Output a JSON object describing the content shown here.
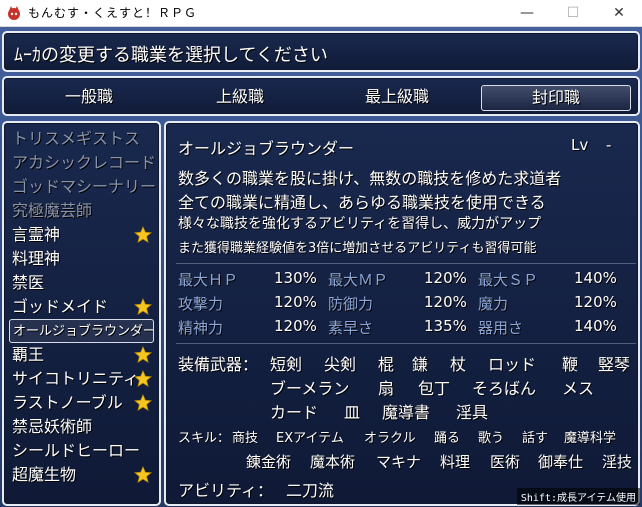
{
  "window": {
    "title": "もんむす・くえすと！ＲＰＧ",
    "minimize": "—",
    "maximize": "☐",
    "close": "✕"
  },
  "help": {
    "text": "ﾑｰｶの変更する職業を選択してください"
  },
  "categories": [
    {
      "label": "一般職",
      "selected": false
    },
    {
      "label": "上級職",
      "selected": false
    },
    {
      "label": "最上級職",
      "selected": false
    },
    {
      "label": "封印職",
      "selected": true
    }
  ],
  "job_list": [
    {
      "label": "トリスメギストス",
      "dim": true,
      "star": false
    },
    {
      "label": "アカシックレコード",
      "dim": true,
      "star": false
    },
    {
      "label": "ゴッドマシーナリー",
      "dim": true,
      "star": false
    },
    {
      "label": "究極魔芸師",
      "dim": true,
      "star": false
    },
    {
      "label": "言霊神",
      "dim": false,
      "star": true
    },
    {
      "label": "料理神",
      "dim": false,
      "star": false
    },
    {
      "label": "禁医",
      "dim": false,
      "star": false
    },
    {
      "label": "ゴッドメイド",
      "dim": false,
      "star": true
    },
    {
      "label": "オールジョブラウンダー",
      "dim": false,
      "star": false,
      "cursor": true
    },
    {
      "label": "覇王",
      "dim": false,
      "star": true
    },
    {
      "label": "サイコトリニティ",
      "dim": false,
      "star": true
    },
    {
      "label": "ラストノーブル",
      "dim": false,
      "star": true
    },
    {
      "label": "禁忌妖術師",
      "dim": false,
      "star": false
    },
    {
      "label": "シールドヒーロー",
      "dim": false,
      "star": false
    },
    {
      "label": "超魔生物",
      "dim": false,
      "star": true
    }
  ],
  "detail": {
    "name": "オールジョブラウンダー",
    "lv_label": "Lv",
    "lv_value": "-",
    "description": [
      "数多くの職業を股に掛け、無数の職技を修めた求道者",
      "全ての職業に精通し、あらゆる職業技を使用できる",
      "様々な職技を強化するアビリティを習得し、威力がアップ",
      "また獲得職業経験値を3倍に増加させるアビリティも習得可能"
    ],
    "stats": [
      [
        {
          "label": "最大ＨＰ",
          "value": "130%"
        },
        {
          "label": "最大ＭＰ",
          "value": "120%"
        },
        {
          "label": "最大ＳＰ",
          "value": "140%"
        }
      ],
      [
        {
          "label": "攻撃力",
          "value": "120%"
        },
        {
          "label": "防御力",
          "value": "120%"
        },
        {
          "label": "魔力",
          "value": "120%"
        }
      ],
      [
        {
          "label": "精神力",
          "value": "120%"
        },
        {
          "label": "素早さ",
          "value": "135%"
        },
        {
          "label": "器用さ",
          "value": "140%"
        }
      ]
    ],
    "weapons_label": "装備武器：",
    "weapons_rows": [
      [
        "短剣",
        "尖剣",
        "棍",
        "鎌",
        "杖",
        "ロッド",
        "鞭",
        "竪琴"
      ],
      [
        "ブーメラン",
        "扇",
        "包丁",
        "そろばん",
        "メス"
      ],
      [
        "カード",
        "皿",
        "魔導書",
        "淫具"
      ]
    ],
    "skills_label": "スキル：",
    "skills_rows": [
      [
        "商技",
        "EXアイテム",
        "オラクル",
        "踊る",
        "歌う",
        "話す",
        "魔導科学"
      ],
      [
        "錬金術",
        "魔本術",
        "マキナ",
        "料理",
        "医術",
        "御奉仕",
        "淫技"
      ]
    ],
    "ability_label": "アビリティ：",
    "ability_value": "二刀流"
  },
  "shift_hint": "Shift:成長アイテム使用",
  "colors": {
    "accent_label": "#8ca6d8",
    "star": "#f7c520",
    "window_border": "#e8ecf4"
  }
}
